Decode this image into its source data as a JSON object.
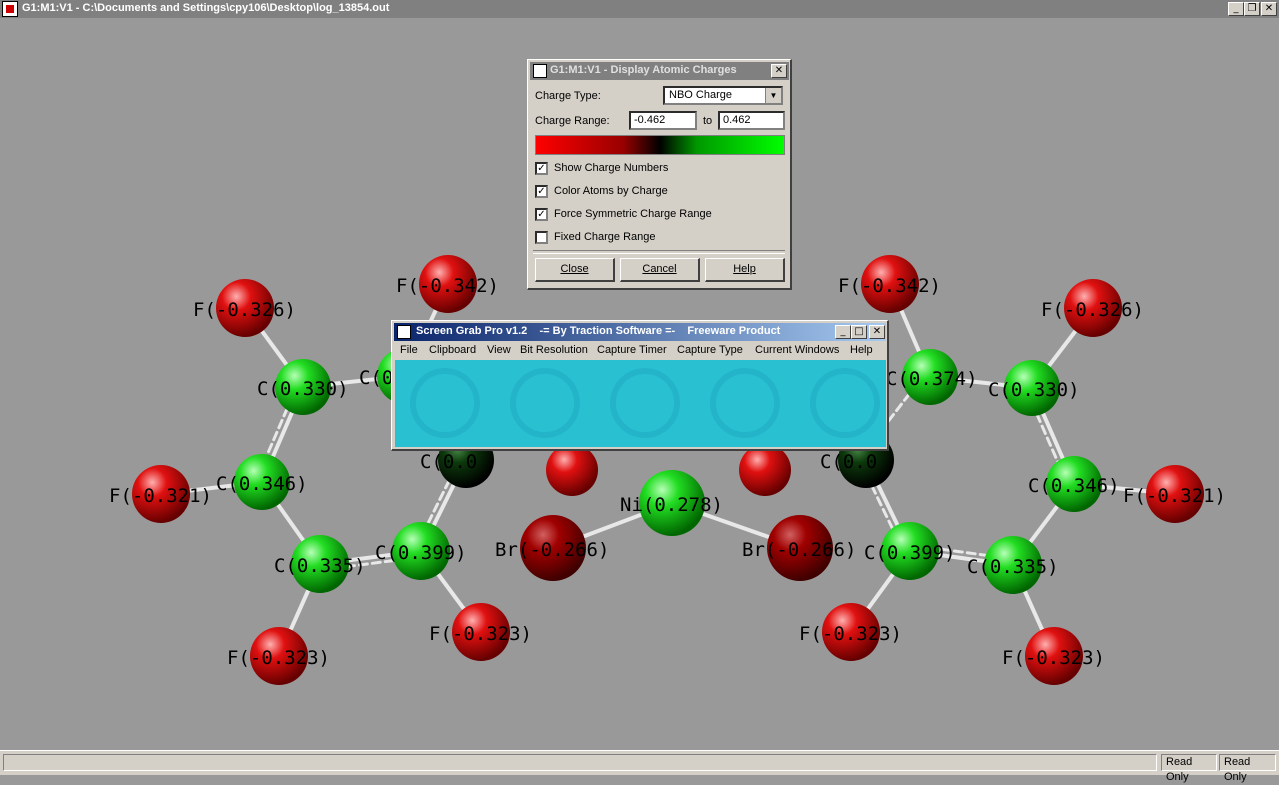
{
  "app": {
    "title": "G1:M1:V1 - C:\\Documents and Settings\\cpy106\\Desktop\\log_13854.out",
    "window_buttons": [
      "_",
      "❐",
      "✕"
    ]
  },
  "colors": {
    "background": "#999999",
    "positive_atom": "#00dd00",
    "negative_atom": "#dd0000",
    "neutral_atom": "#003300"
  },
  "atoms": [
    {
      "label": "F(-0.326)",
      "charge": -0.326,
      "color": "red"
    },
    {
      "label": "F(-0.342)",
      "charge": -0.342,
      "color": "red"
    },
    {
      "label": "F(-0.342)",
      "charge": -0.342,
      "color": "red"
    },
    {
      "label": "F(-0.326)",
      "charge": -0.326,
      "color": "red"
    },
    {
      "label": "C(0.330)",
      "charge": 0.33,
      "color": "green"
    },
    {
      "label": "C(0.3",
      "charge": 0.3,
      "color": "green"
    },
    {
      "label": "C(0.374)",
      "charge": 0.374,
      "color": "green"
    },
    {
      "label": "C(0.330)",
      "charge": 0.33,
      "color": "green"
    },
    {
      "label": "F(-0.321)",
      "charge": -0.321,
      "color": "red"
    },
    {
      "label": "C(0.346)",
      "charge": 0.346,
      "color": "green"
    },
    {
      "label": "C(0.0",
      "charge": 0.0,
      "color": "dark"
    },
    {
      "label": "C(0.0",
      "charge": 0.0,
      "color": "dark"
    },
    {
      "label": "C(0.346)",
      "charge": 0.346,
      "color": "green"
    },
    {
      "label": "F(-0.321)",
      "charge": -0.321,
      "color": "red"
    },
    {
      "label": "Ni(0.278)",
      "charge": 0.278,
      "color": "green"
    },
    {
      "label": "Br(-0.266)",
      "charge": -0.266,
      "color": "darkred"
    },
    {
      "label": "Br(-0.266)",
      "charge": -0.266,
      "color": "darkred"
    },
    {
      "label": "C(0.335)",
      "charge": 0.335,
      "color": "green"
    },
    {
      "label": "C(0.399)",
      "charge": 0.399,
      "color": "green"
    },
    {
      "label": "C(0.399)",
      "charge": 0.399,
      "color": "green"
    },
    {
      "label": "C(0.335)",
      "charge": 0.335,
      "color": "green"
    },
    {
      "label": "F(-0.323)",
      "charge": -0.323,
      "color": "red"
    },
    {
      "label": "F(-0.323)",
      "charge": -0.323,
      "color": "red"
    },
    {
      "label": "F(-0.323)",
      "charge": -0.323,
      "color": "red"
    },
    {
      "label": "F(-0.323)",
      "charge": -0.323,
      "color": "red"
    },
    {
      "label": "",
      "charge": null,
      "color": "red"
    },
    {
      "label": "",
      "charge": null,
      "color": "red"
    }
  ],
  "dialog": {
    "title": "G1:M1:V1 - Display Atomic Charges",
    "charge_type_label": "Charge Type:",
    "charge_type_value": "NBO Charge",
    "charge_range_label": "Charge Range:",
    "range_min": "-0.462",
    "range_to": "to",
    "range_max": "0.462",
    "checkboxes": [
      {
        "label": "Show Charge Numbers",
        "checked": true
      },
      {
        "label": "Color Atoms by Charge",
        "checked": true
      },
      {
        "label": "Force Symmetric Charge Range",
        "checked": true
      },
      {
        "label": "Fixed Charge Range",
        "checked": false
      }
    ],
    "buttons": [
      "Close",
      "Cancel",
      "Help"
    ],
    "close_glyph": "✕"
  },
  "grab": {
    "title": "Screen Grab Pro v1.2    -= By Traction Software =-    Freeware Product",
    "menu": [
      "File",
      "Clipboard",
      "View",
      "Bit Resolution",
      "Capture Timer",
      "Capture Type",
      "Current Windows",
      "Help"
    ],
    "window_buttons": [
      "_",
      "□",
      "✕"
    ]
  },
  "status": {
    "field1": "Read Only",
    "field2": "Read Only"
  }
}
